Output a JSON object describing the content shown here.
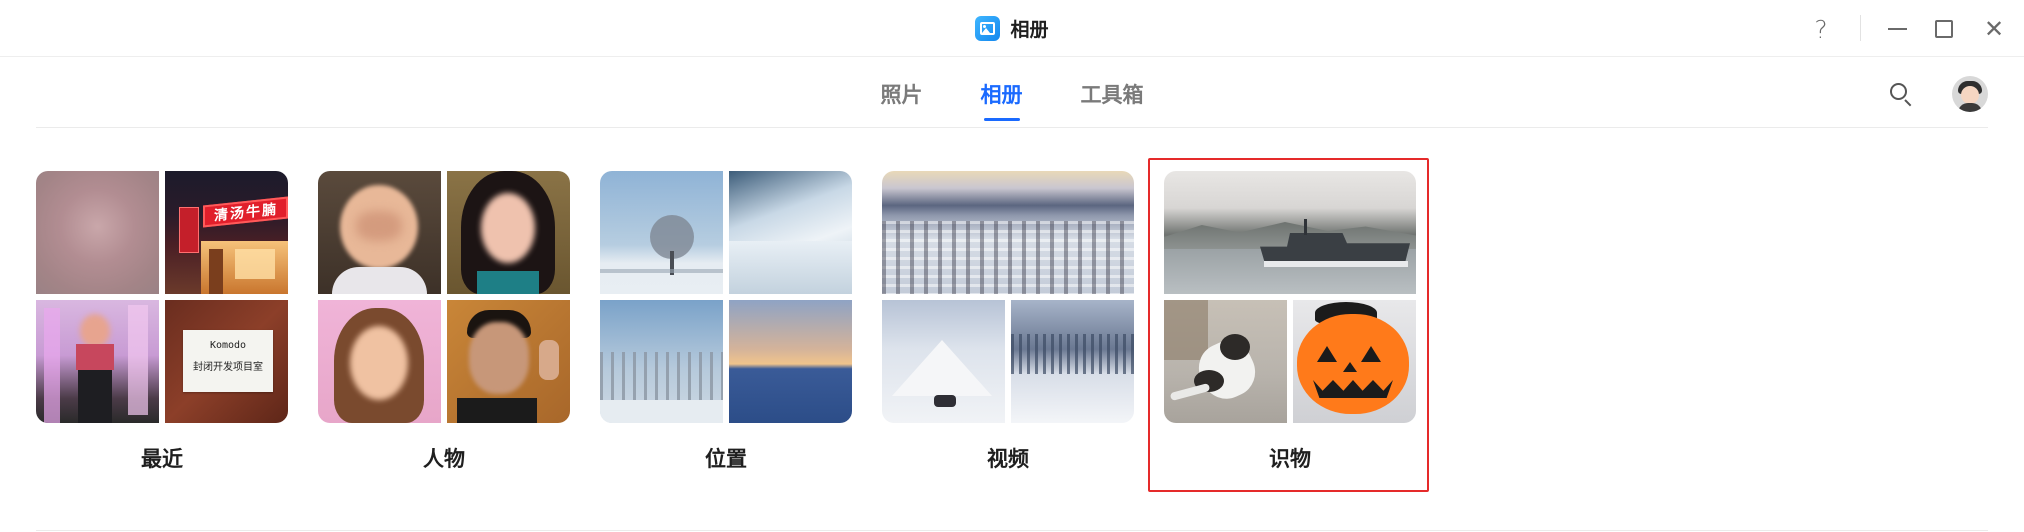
{
  "window": {
    "app_title": "相册",
    "app_icon": "photos-app-icon",
    "controls": {
      "help_glyph": "?",
      "close_glyph": "✕"
    }
  },
  "nav": {
    "tabs": [
      {
        "label": "照片",
        "active": false
      },
      {
        "label": "相册",
        "active": true
      },
      {
        "label": "工具箱",
        "active": false
      }
    ],
    "search_icon": "search-icon",
    "avatar_icon": "user-avatar"
  },
  "albums": [
    {
      "label": "最近",
      "layout": "grid-2x2"
    },
    {
      "label": "人物",
      "layout": "grid-2x2"
    },
    {
      "label": "位置",
      "layout": "grid-2x2"
    },
    {
      "label": "视频",
      "layout": "top-wide"
    },
    {
      "label": "识物",
      "layout": "top-wide",
      "selected": true
    }
  ],
  "thumbnail_text": {
    "shop_sign": "清汤牛腩",
    "note_line1": "Komodo",
    "note_line2": "封闭开发项目室"
  },
  "colors": {
    "accent": "#1a6aff",
    "selection": "#e52a2a",
    "tab_inactive": "#7a7a7a"
  }
}
